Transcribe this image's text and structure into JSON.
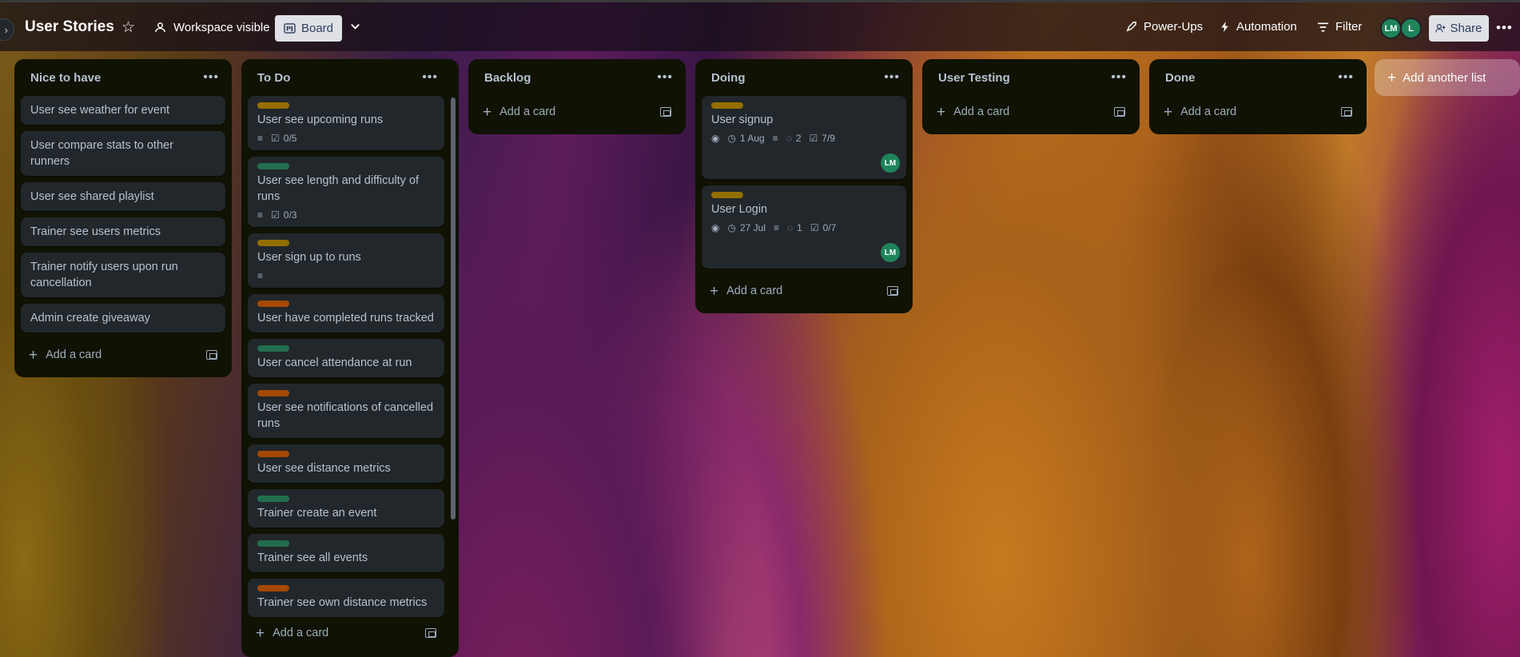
{
  "header": {
    "board_title": "User Stories",
    "visibility": "Workspace visible",
    "view": "Board",
    "power_ups": "Power-Ups",
    "automation": "Automation",
    "filter": "Filter",
    "members": [
      "LM",
      "L"
    ],
    "share": "Share"
  },
  "labels": {
    "yellow": "#946f00",
    "green": "#216e4e",
    "orange": "#a54800"
  },
  "lists": [
    {
      "title": "Nice to have",
      "add_card": "Add a card",
      "cards": [
        {
          "title": "User see weather for event"
        },
        {
          "title": "User compare stats to other runners"
        },
        {
          "title": "User see shared playlist"
        },
        {
          "title": "Trainer see users metrics"
        },
        {
          "title": "Trainer notify users upon run cancellation"
        },
        {
          "title": "Admin create giveaway"
        }
      ]
    },
    {
      "title": "To Do",
      "add_card": "Add a card",
      "cards": [
        {
          "title": "User see upcoming runs",
          "checklist": "0/5"
        },
        {
          "title": "User see length and difficulty of runs",
          "checklist": "0/3"
        },
        {
          "title": "User sign up to runs"
        },
        {
          "title": "User have completed runs tracked"
        },
        {
          "title": "User cancel attendance at run"
        },
        {
          "title": "User see notifications of cancelled runs"
        },
        {
          "title": "User see distance metrics"
        },
        {
          "title": "Trainer create an event"
        },
        {
          "title": "Trainer see all events"
        },
        {
          "title": "Trainer see own distance metrics"
        }
      ]
    },
    {
      "title": "Backlog",
      "add_card": "Add a card"
    },
    {
      "title": "Doing",
      "add_card": "Add a card",
      "cards": [
        {
          "title": "User signup",
          "due": "1 Aug",
          "comments": "2",
          "checklist": "7/9",
          "member": "LM"
        },
        {
          "title": "User Login",
          "due": "27 Jul",
          "comments": "1",
          "checklist": "0/7",
          "member": "LM"
        }
      ]
    },
    {
      "title": "User Testing",
      "add_card": "Add a card"
    },
    {
      "title": "Done",
      "add_card": "Add a card"
    }
  ],
  "add_list": "Add another list"
}
